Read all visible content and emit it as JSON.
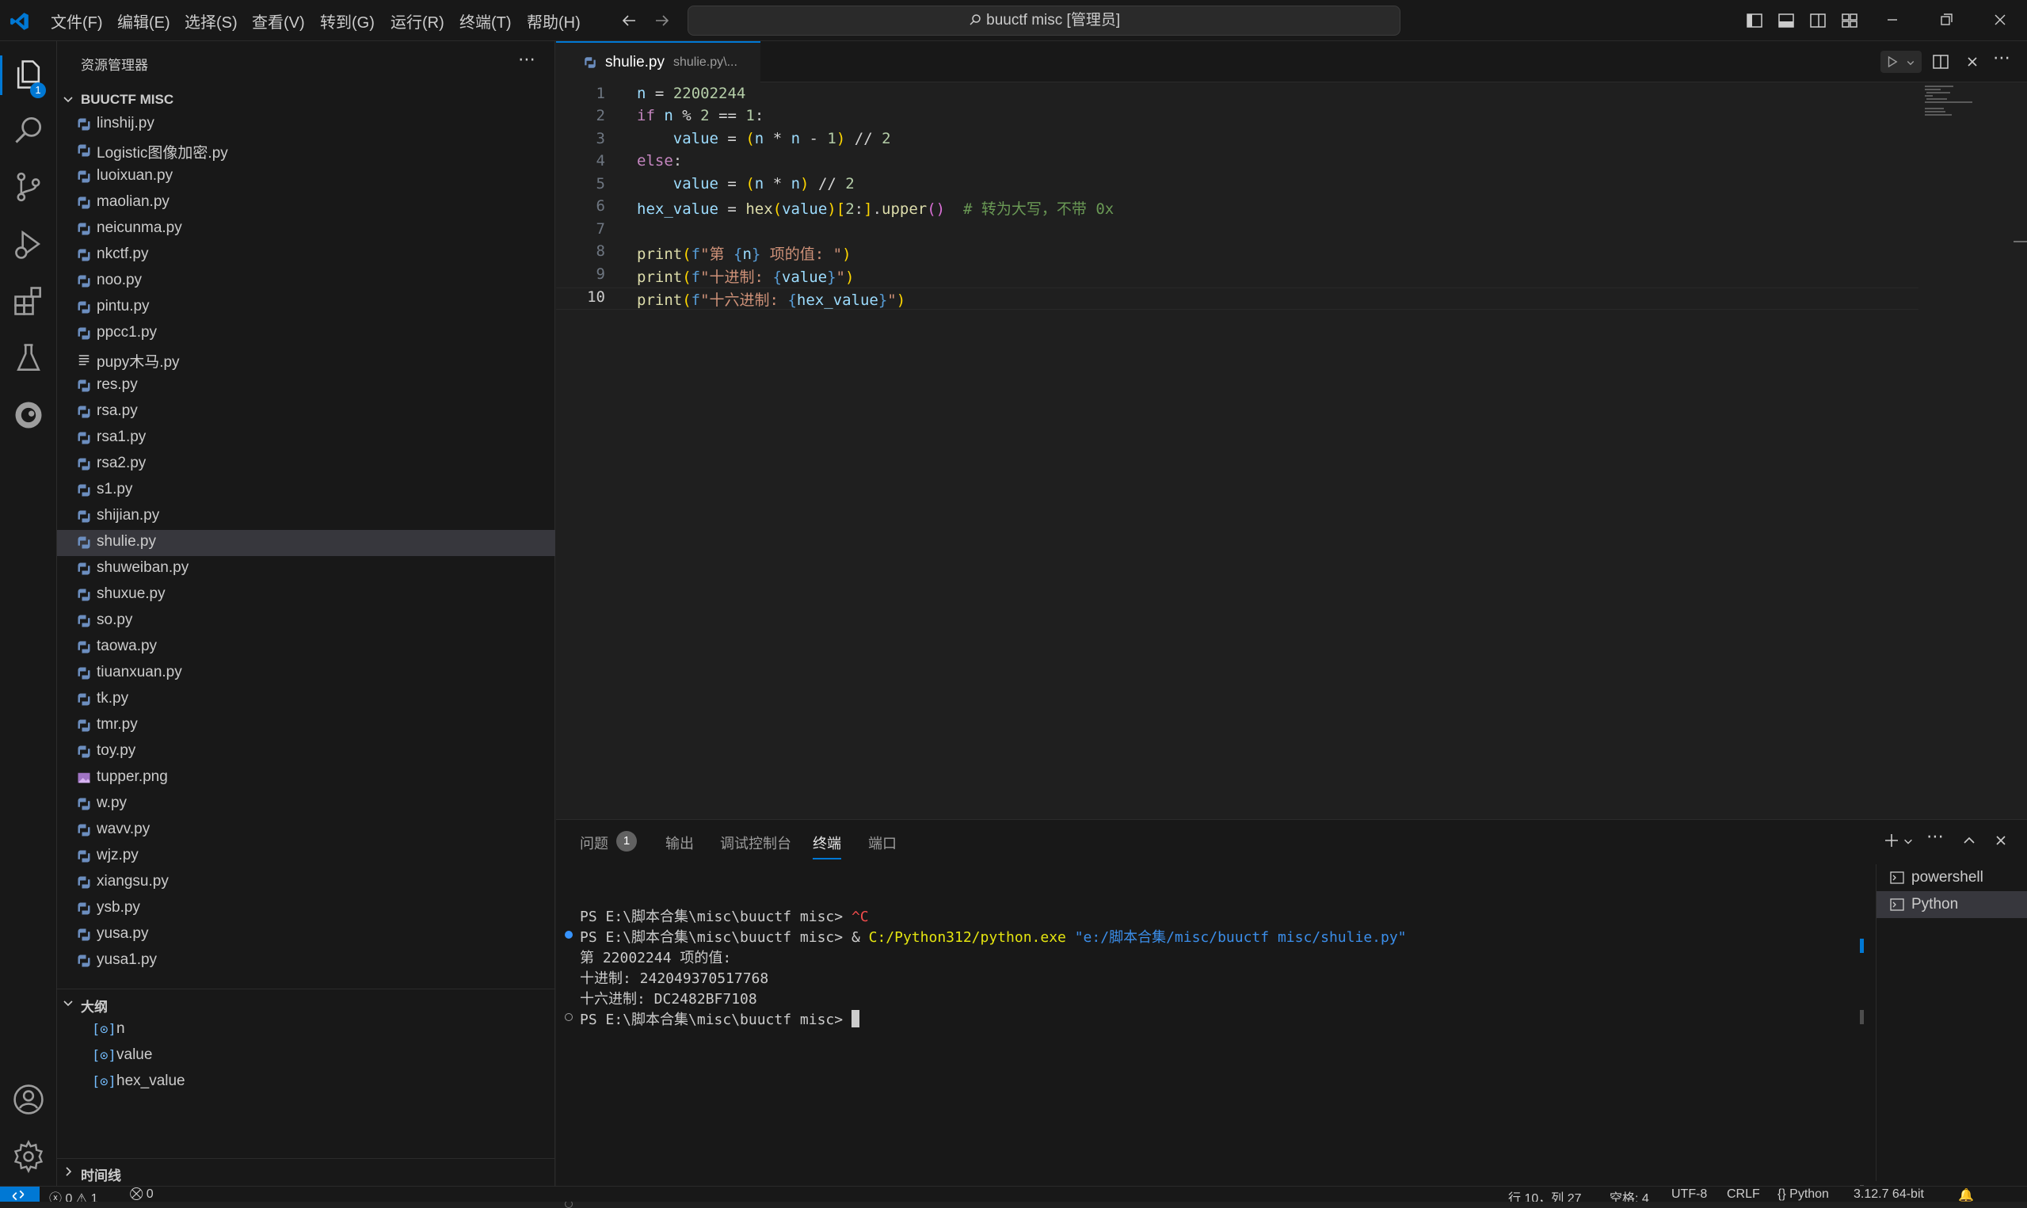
{
  "titlebar": {
    "menus": [
      "文件(F)",
      "编辑(E)",
      "选择(S)",
      "查看(V)",
      "转到(G)",
      "运行(R)",
      "终端(T)",
      "帮助(H)"
    ],
    "search_text": "buuctf misc [管理员]"
  },
  "activity": {
    "explorer_badge": "1"
  },
  "sidebar": {
    "title": "资源管理器",
    "root": "BUUCTF MISC",
    "files": [
      {
        "name": "linshij.py",
        "type": "py"
      },
      {
        "name": "Logistic图像加密.py",
        "type": "py"
      },
      {
        "name": "luoixuan.py",
        "type": "py"
      },
      {
        "name": "maolian.py",
        "type": "py"
      },
      {
        "name": "neicunma.py",
        "type": "py"
      },
      {
        "name": "nkctf.py",
        "type": "py"
      },
      {
        "name": "noo.py",
        "type": "py"
      },
      {
        "name": "pintu.py",
        "type": "py"
      },
      {
        "name": "ppcc1.py",
        "type": "py"
      },
      {
        "name": "pupy木马.py",
        "type": "txt"
      },
      {
        "name": "res.py",
        "type": "py"
      },
      {
        "name": "rsa.py",
        "type": "py"
      },
      {
        "name": "rsa1.py",
        "type": "py"
      },
      {
        "name": "rsa2.py",
        "type": "py"
      },
      {
        "name": "s1.py",
        "type": "py"
      },
      {
        "name": "shijian.py",
        "type": "py"
      },
      {
        "name": "shulie.py",
        "type": "py"
      },
      {
        "name": "shuweiban.py",
        "type": "py"
      },
      {
        "name": "shuxue.py",
        "type": "py"
      },
      {
        "name": "so.py",
        "type": "py"
      },
      {
        "name": "taowa.py",
        "type": "py"
      },
      {
        "name": "tiuanxuan.py",
        "type": "py"
      },
      {
        "name": "tk.py",
        "type": "py"
      },
      {
        "name": "tmr.py",
        "type": "py"
      },
      {
        "name": "toy.py",
        "type": "py"
      },
      {
        "name": "tupper.png",
        "type": "img"
      },
      {
        "name": "w.py",
        "type": "py"
      },
      {
        "name": "wavv.py",
        "type": "py"
      },
      {
        "name": "wjz.py",
        "type": "py"
      },
      {
        "name": "xiangsu.py",
        "type": "py"
      },
      {
        "name": "ysb.py",
        "type": "py"
      },
      {
        "name": "yusa.py",
        "type": "py"
      },
      {
        "name": "yusa1.py",
        "type": "py"
      }
    ],
    "selected_file": "shulie.py",
    "outline_title": "大纲",
    "outline": [
      "n",
      "value",
      "hex_value"
    ],
    "timeline_title": "时间线"
  },
  "editor": {
    "tab_name": "shulie.py",
    "tab_path": "shulie.py\\...",
    "line_numbers": [
      "1",
      "2",
      "3",
      "4",
      "5",
      "6",
      "7",
      "8",
      "9",
      "10"
    ],
    "current_line": "10"
  },
  "panel": {
    "tabs": [
      "问题",
      "输出",
      "调试控制台",
      "终端",
      "端口"
    ],
    "problems_badge": "1",
    "active_tab": "终端",
    "terminal_lines": [
      "PS E:\\脚本合集\\misc\\buuctf misc> ",
      "PS E:\\脚本合集\\misc\\buuctf misc> ",
      "第 22002244 项的值:",
      "十进制: 242049370517768",
      "十六进制: DC2482BF7108",
      "PS E:\\脚本合集\\misc\\buuctf misc> "
    ],
    "ctrl_c": "^C",
    "command_amp": "& ",
    "command_exe": "C:/Python312/python.exe",
    "command_arg": "\"e:/脚本合集/misc/buuctf misc/shulie.py\"",
    "terminals": [
      "powershell",
      "Python"
    ]
  },
  "statusbar": {
    "errors": "0",
    "warnings": "1",
    "ports": "0",
    "line_col": "行 10，列 27",
    "spaces": "空格: 4",
    "encoding": "UTF-8",
    "eol": "CRLF",
    "language": "Python",
    "interpreter": "3.12.7 64-bit"
  },
  "colors": {
    "accent": "#0078d4",
    "background": "#1f1f1f",
    "sidebar": "#181818"
  }
}
